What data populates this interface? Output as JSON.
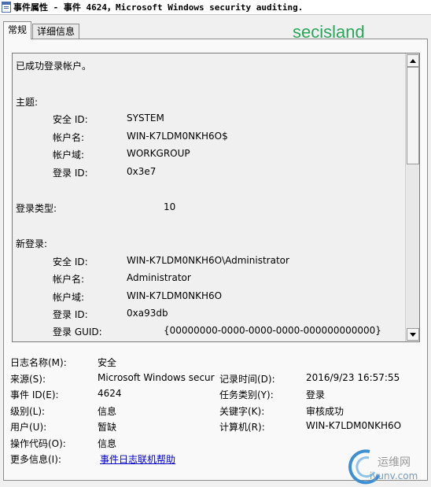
{
  "window": {
    "title": "事件属性 - 事件 4624，Microsoft Windows security auditing."
  },
  "tabs": [
    {
      "label": "常规",
      "active": true
    },
    {
      "label": "详细信息",
      "active": false
    }
  ],
  "watermark": {
    "text": "secisland",
    "color": "#2aa65a"
  },
  "description": {
    "intro": "已成功登录帐户。",
    "subject": {
      "heading": "主题:",
      "fields": [
        {
          "label": "安全 ID:",
          "value": "SYSTEM"
        },
        {
          "label": "帐户名:",
          "value": "WIN-K7LDM0NKH6O$"
        },
        {
          "label": "帐户域:",
          "value": "WORKGROUP"
        },
        {
          "label": "登录 ID:",
          "value": "0x3e7"
        }
      ]
    },
    "logon_type": {
      "label": "登录类型:",
      "value": "10"
    },
    "new_logon": {
      "heading": "新登录:",
      "fields": [
        {
          "label": "安全 ID:",
          "value": "WIN-K7LDM0NKH6O\\Administrator"
        },
        {
          "label": "帐户名:",
          "value": "Administrator"
        },
        {
          "label": "帐户域:",
          "value": "WIN-K7LDM0NKH6O"
        },
        {
          "label": "登录 ID:",
          "value": "0xa93db"
        },
        {
          "label": "登录 GUID:",
          "value": "{00000000-0000-0000-0000-000000000000}"
        }
      ]
    },
    "scrollbar": {
      "position_fraction": 0.0
    }
  },
  "properties": {
    "log_name": {
      "label": "日志名称(M):",
      "value": "安全"
    },
    "source": {
      "label": "来源(S):",
      "value": "Microsoft Windows secur"
    },
    "logged": {
      "label": "记录时间(D):",
      "value": "2016/9/23 16:57:55"
    },
    "event_id": {
      "label": "事件 ID(E):",
      "value": "4624"
    },
    "task_category": {
      "label": "任务类别(Y):",
      "value": "登录"
    },
    "level": {
      "label": "级别(L):",
      "value": "信息"
    },
    "keywords": {
      "label": "关键字(K):",
      "value": "审核成功"
    },
    "user": {
      "label": "用户(U):",
      "value": "暂缺"
    },
    "computer": {
      "label": "计算机(R):",
      "value": "WIN-K7LDM0NKH6O"
    },
    "opcode": {
      "label": "操作代码(O):",
      "value": "信息"
    },
    "more_info": {
      "label": "更多信息(I):",
      "link": "事件日志联机帮助"
    }
  },
  "logo": {
    "cn": "运维网",
    "en": "iyunv.com"
  }
}
